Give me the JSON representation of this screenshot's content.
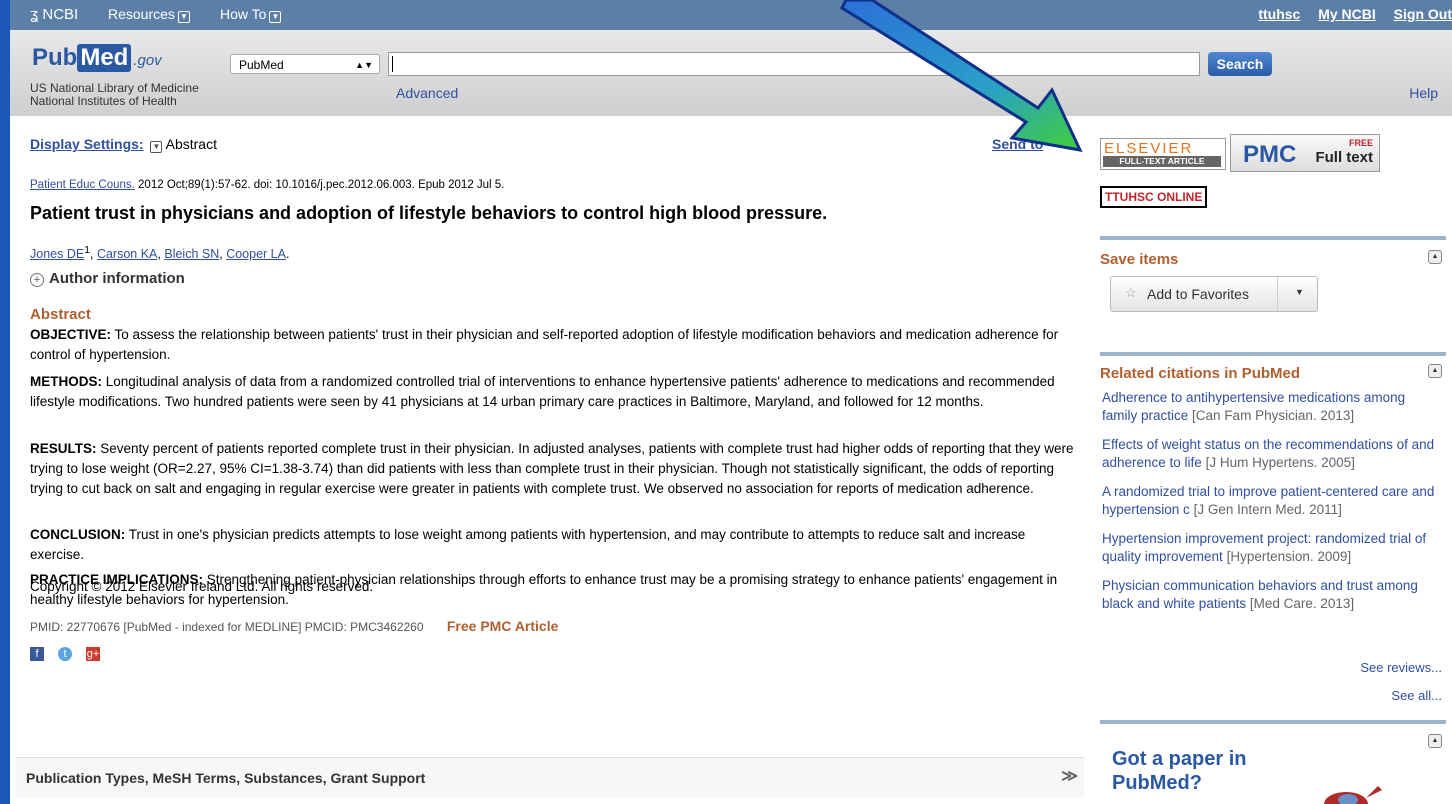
{
  "topbar": {
    "ncbi": "NCBI",
    "resources": "Resources",
    "howto": "How To",
    "user": "ttuhsc",
    "myncbi": "My NCBI",
    "signout": "Sign Out"
  },
  "header": {
    "logo_pub": "Pub",
    "logo_med": "Med",
    "logo_gov": ".gov",
    "library": "US National Library of Medicine National Institutes of Health",
    "db_selected": "PubMed",
    "search_label": "Search",
    "advanced": "Advanced",
    "help": "Help"
  },
  "article": {
    "display_settings": "Display Settings:",
    "display_mode": "Abstract",
    "send_to": "Send to",
    "journal": "Patient Educ Couns.",
    "citation": " 2012 Oct;89(1):57-62. doi: 10.1016/j.pec.2012.06.003. Epub 2012 Jul 5.",
    "title": "Patient trust in physicians and adoption of lifestyle behaviors to control high blood pressure.",
    "authors": [
      "Jones DE",
      "Carson KA",
      "Bleich SN",
      "Cooper LA"
    ],
    "author_sup": "1",
    "author_info": "Author information",
    "abstract_heading": "Abstract",
    "objective_label": "OBJECTIVE:",
    "objective": " To assess the relationship between patients' trust in their physician and self-reported adoption of lifestyle modification behaviors and medication adherence for control of hypertension.",
    "methods_label": "METHODS:",
    "methods": " Longitudinal analysis of data from a randomized controlled trial of interventions to enhance hypertensive patients' adherence to medications and recommended lifestyle modifications. Two hundred patients were seen by 41 physicians at 14 urban primary care practices in Baltimore, Maryland, and followed for 12 months.",
    "results_label": "RESULTS:",
    "results": " Seventy percent of patients reported complete trust in their physician. In adjusted analyses, patients with complete trust had higher odds of reporting that they were trying to lose weight (OR=2.27, 95% CI=1.38-3.74) than did patients with less than complete trust in their physician. Though not statistically significant, the odds of reporting trying to cut back on salt and engaging in regular exercise were greater in patients with complete trust. We observed no association for reports of medication adherence.",
    "conclusion_label": "CONCLUSION:",
    "conclusion": " Trust in one's physician predicts attempts to lose weight among patients with hypertension, and may contribute to attempts to reduce salt and increase exercise.",
    "practice_label": "PRACTICE IMPLICATIONS:",
    "practice": " Strengthening patient-physician relationships through efforts to enhance trust may be a promising strategy to enhance patients' engagement in healthy lifestyle behaviors for hypertension.",
    "copyright": "Copyright © 2012 Elsevier Ireland Ltd. All rights reserved.",
    "pmid": "PMID: 22770676 [PubMed - indexed for MEDLINE]   PMCID: PMC3462260",
    "free_pmc": "Free PMC Article",
    "pubtypes": "Publication Types, MeSH Terms, Substances, Grant Support"
  },
  "sidebar": {
    "elsevier_top": "ELSEVIER",
    "elsevier_bottom": "FULL-TEXT ARTICLE",
    "pmc": "PMC",
    "pmc_free": "FREE",
    "pmc_fulltext": "Full text",
    "ttuhsc": "TTUHSC ONLINE",
    "save_items": "Save items",
    "add_favorites": "Add to Favorites",
    "related_heading": "Related citations in PubMed",
    "related": [
      {
        "title": "Adherence to antihypertensive medications among family practice",
        "source": "[Can Fam Physician. 2013]"
      },
      {
        "title": "Effects of weight status on the recommendations of and adherence to life",
        "source": "[J Hum Hypertens. 2005]"
      },
      {
        "title": "A randomized trial to improve patient-centered care and hypertension c",
        "source": "[J Gen Intern Med. 2011]"
      },
      {
        "title": "Hypertension improvement project: randomized trial of quality improvement",
        "source": "[Hypertension. 2009]"
      },
      {
        "title": "Physician communication behaviors and trust among black and white patients",
        "source": "[Med Care. 2013]"
      }
    ],
    "see_reviews": "See reviews...",
    "see_all": "See all...",
    "got_paper": "Got a paper in PubMed?"
  },
  "colors": {
    "ncbi_bar": "#5c7fa8",
    "link": "#2f4f9f",
    "heading_orange": "#b06030",
    "annotation_arrow": "#3fcf3a"
  }
}
